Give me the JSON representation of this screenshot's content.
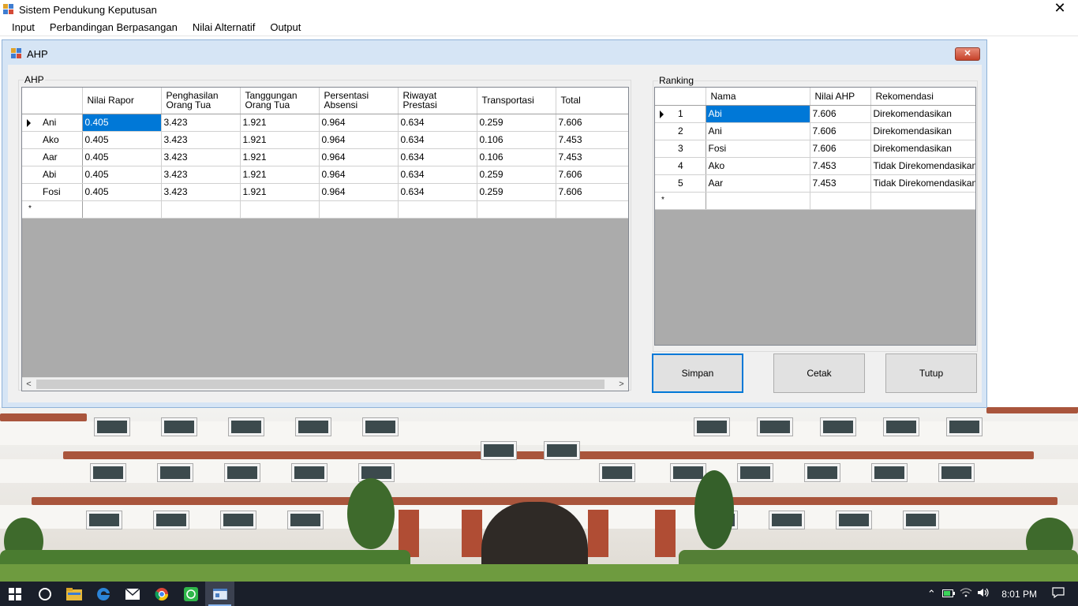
{
  "app": {
    "title": "Sistem Pendukung Keputusan",
    "close_glyph": "✕"
  },
  "menu": [
    "Input",
    "Perbandingan Berpasangan",
    "Nilai Alternatif",
    "Output"
  ],
  "child_window": {
    "title": "AHP",
    "close_glyph": "✕"
  },
  "ahp_group": {
    "label": "AHP",
    "columns": [
      [
        "Nilai Rapor",
        ""
      ],
      [
        "Penghasilan",
        "Orang Tua"
      ],
      [
        "Tanggungan",
        "Orang Tua"
      ],
      [
        "Persentasi",
        "Absensi"
      ],
      [
        "Riwayat",
        "Prestasi"
      ],
      [
        "Transportasi",
        ""
      ],
      [
        "Total",
        ""
      ]
    ],
    "rows": [
      {
        "name": "Ani",
        "values": [
          "0.405",
          "3.423",
          "1.921",
          "0.964",
          "0.634",
          "0.259",
          "7.606"
        ]
      },
      {
        "name": "Ako",
        "values": [
          "0.405",
          "3.423",
          "1.921",
          "0.964",
          "0.634",
          "0.106",
          "7.453"
        ]
      },
      {
        "name": "Aar",
        "values": [
          "0.405",
          "3.423",
          "1.921",
          "0.964",
          "0.634",
          "0.106",
          "7.453"
        ]
      },
      {
        "name": "Abi",
        "values": [
          "0.405",
          "3.423",
          "1.921",
          "0.964",
          "0.634",
          "0.259",
          "7.606"
        ]
      },
      {
        "name": "Fosi",
        "values": [
          "0.405",
          "3.423",
          "1.921",
          "0.964",
          "0.634",
          "0.259",
          "7.606"
        ]
      }
    ],
    "new_row_marker": "*",
    "scroll_left": "<",
    "scroll_right": ">"
  },
  "ranking_group": {
    "label": "Ranking",
    "columns": [
      "Nama",
      "Nilai AHP",
      "Rekomendasi"
    ],
    "rows": [
      {
        "rank": "1",
        "name": "Abi",
        "score": "7.606",
        "rec": "Direkomendasikan"
      },
      {
        "rank": "2",
        "name": "Ani",
        "score": "7.606",
        "rec": "Direkomendasikan"
      },
      {
        "rank": "3",
        "name": "Fosi",
        "score": "7.606",
        "rec": "Direkomendasikan"
      },
      {
        "rank": "4",
        "name": "Ako",
        "score": "7.453",
        "rec": "Tidak Direkomendasikan"
      },
      {
        "rank": "5",
        "name": "Aar",
        "score": "7.453",
        "rec": "Tidak Direkomendasikan"
      }
    ],
    "new_row_marker": "*"
  },
  "buttons": {
    "save": "Simpan",
    "print": "Cetak",
    "close": "Tutup"
  },
  "taskbar": {
    "icons": [
      "windows-start-icon",
      "cortana-search-icon",
      "file-explorer-icon",
      "edge-browser-icon",
      "mail-icon",
      "chrome-icon",
      "whatsapp-icon",
      "app-window-icon"
    ],
    "clock": "8:01 PM",
    "tray": [
      "chevron-up-icon",
      "battery-icon",
      "wifi-icon",
      "volume-icon",
      "notification-icon"
    ]
  },
  "colors": {
    "selection": "#0078d7",
    "window_frame": "#d6e5f5",
    "taskbar": "#1a1f2a"
  }
}
